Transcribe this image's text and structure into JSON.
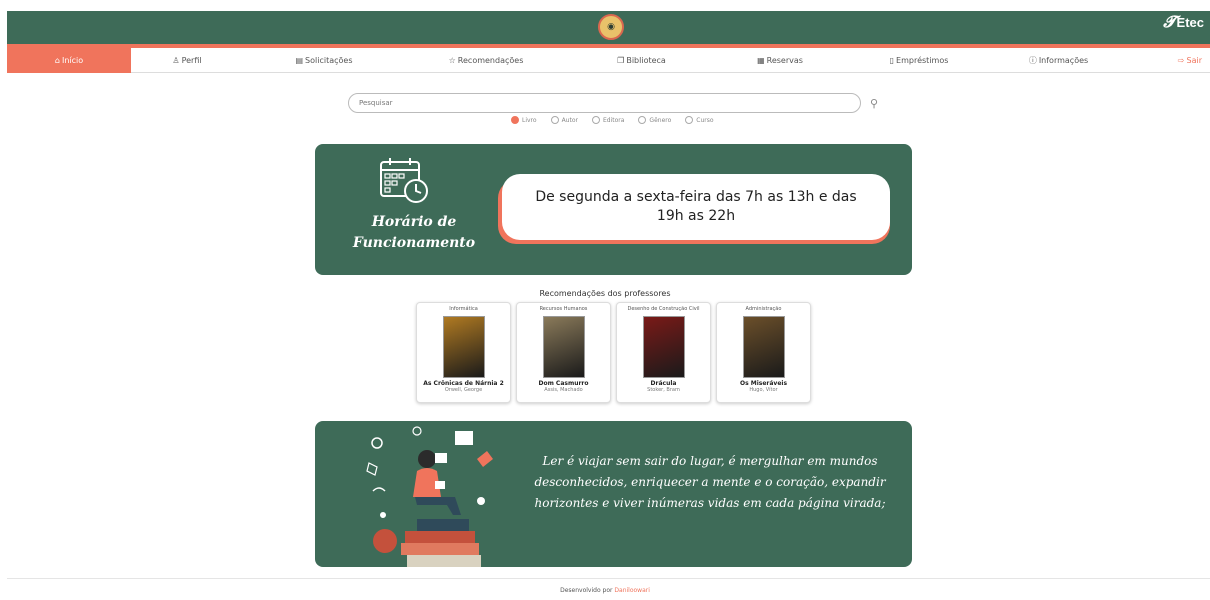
{
  "brand": {
    "name": "Etec",
    "sub": ""
  },
  "nav": [
    {
      "label": "Início",
      "icon": "home-icon",
      "glyph": "⌂",
      "active": true
    },
    {
      "label": "Perfil",
      "icon": "user-icon",
      "glyph": "♙"
    },
    {
      "label": "Solicitações",
      "icon": "inbox-icon",
      "glyph": "▤"
    },
    {
      "label": "Recomendações",
      "icon": "star-icon",
      "glyph": "☆"
    },
    {
      "label": "Biblioteca",
      "icon": "book-open-icon",
      "glyph": "❐"
    },
    {
      "label": "Reservas",
      "icon": "calendar-icon",
      "glyph": "▦"
    },
    {
      "label": "Empréstimos",
      "icon": "phone-icon",
      "glyph": "▯"
    },
    {
      "label": "Informações",
      "icon": "info-icon",
      "glyph": "ⓘ"
    },
    {
      "label": "Sair",
      "icon": "logout-icon",
      "glyph": "⇨"
    }
  ],
  "search": {
    "placeholder": "Pesquisar"
  },
  "filters": [
    {
      "label": "Livro",
      "selected": true
    },
    {
      "label": "Autor",
      "selected": false
    },
    {
      "label": "Editora",
      "selected": false
    },
    {
      "label": "Gênero",
      "selected": false
    },
    {
      "label": "Curso",
      "selected": false
    }
  ],
  "hours": {
    "title_line1": "Horário de",
    "title_line2": "Funcionamento",
    "text": "De segunda a sexta-feira das 7h as 13h e das 19h as 22h"
  },
  "recommendations": {
    "title": "Recomendações dos professores",
    "books": [
      {
        "course": "Informática",
        "title": "As Crônicas de Nárnia 2",
        "author": "Orwell, George",
        "cover_color": "#b07a22"
      },
      {
        "course": "Recursos Humanos",
        "title": "Dom Casmurro",
        "author": "Assis, Machado",
        "cover_color": "#8a7a5a"
      },
      {
        "course": "Desenho de Construção Civil",
        "title": "Drácula",
        "author": "Stoker, Bram",
        "cover_color": "#7a1a18"
      },
      {
        "course": "Administração",
        "title": "Os Miseráveis",
        "author": "Hugo, Vítor",
        "cover_color": "#6b4f2a"
      }
    ]
  },
  "quote": {
    "text": "Ler é viajar sem sair do lugar, é mergulhar em mundos desconhecidos, enriquecer a mente e o coração, expandir horizontes e viver inúmeras vidas em cada página virada;"
  },
  "footer": {
    "prefix": "Desenvolvido por",
    "author": "Daniloowari"
  },
  "colors": {
    "accent": "#f0745c",
    "primary": "#3e6b58"
  }
}
